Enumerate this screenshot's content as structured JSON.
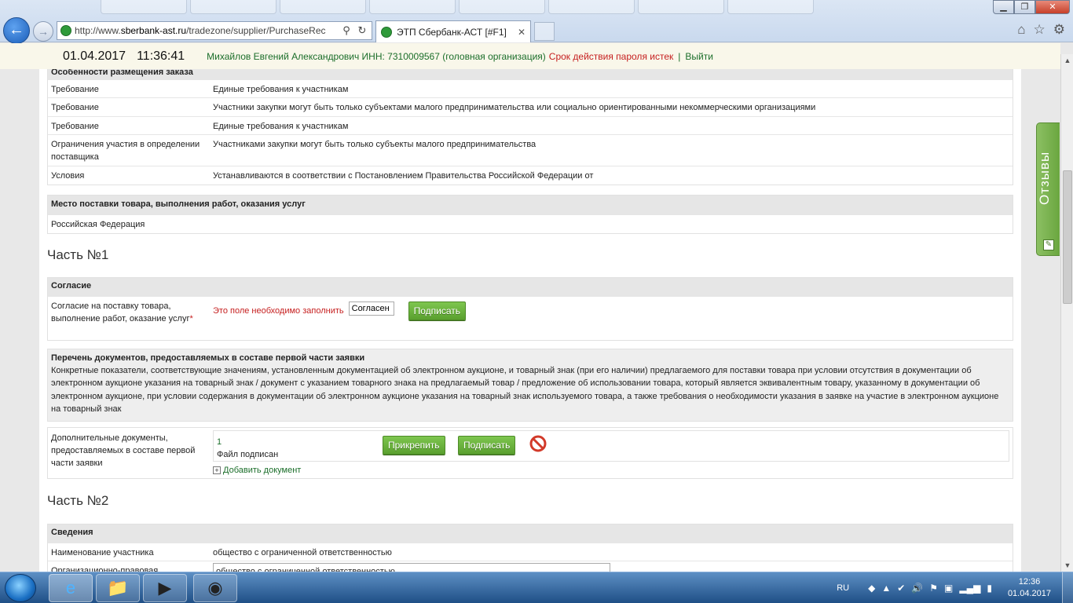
{
  "browser": {
    "url_prefix": "http://www.",
    "url_domain": "sberbank-ast.ru",
    "url_path": "/tradezone/supplier/PurchaseRec",
    "tab_title": "ЭТП Сбербанк-АСТ [#F1]",
    "close_symbol": "✕",
    "min_symbol": "▁",
    "max_symbol": "❐",
    "search_symbol": "⚲",
    "refresh_symbol": "↻",
    "tab_close_symbol": "✕"
  },
  "header": {
    "date": "01.04.2017",
    "time": "11:36:41",
    "user": "Михайлов Евгений Александрович ИНН: 7310009567 (головная организация)",
    "password_warning": "Срок действия пароля истек",
    "separator": "|",
    "logout": "Выйти"
  },
  "feedback": {
    "label": "Отзывы"
  },
  "placement": {
    "title": "Особенности размещения заказа",
    "rows": [
      {
        "label": "Требование",
        "value": "Единые требования к участникам"
      },
      {
        "label": "Требование",
        "value": "Участники закупки могут быть только субъектами малого предпринимательства или социально ориентированными некоммерческими организациями"
      },
      {
        "label": "Требование",
        "value": "Единые требования к участникам"
      },
      {
        "label": "Ограничения участия в определении поставщика",
        "value": "Участниками закупки могут быть только субъекты малого предпринимательства"
      },
      {
        "label": "Условия",
        "value": "Устанавливаются в соответствии с Постановлением Правительства Российской Федерации от"
      }
    ]
  },
  "delivery": {
    "title": "Место поставки товара, выполнения работ, оказания услуг",
    "value": "Российская Федерация"
  },
  "part1": {
    "title": "Часть №1",
    "consent": {
      "title": "Согласие",
      "label": "Согласие на поставку товара, выполнение работ, оказание услуг",
      "required_mark": "*",
      "error": "Это поле необходимо заполнить",
      "input_value": "Согласен",
      "sign_button": "Подписать"
    },
    "docs": {
      "title": "Перечень документов, предоставляемых в составе первой части заявки",
      "description": "Конкретные показатели, соответствующие значениям, установленным документацией об электронном аукционе, и товарный знак (при его наличии) предлагаемого для поставки товара при условии отсутствия в документации об электронном аукционе указания на товарный знак / документ с указанием товарного знака на предлагаемый товар / предложение об использовании товара, который является эквивалентным товару, указанному в документации об электронном аукционе, при условии содержания в документации об электронном аукционе указания на товарный знак используемого товара, а также требования о необходимости указания в заявке на участие в электронном аукционе на товарный знак"
    },
    "additional": {
      "label": "Дополнительные документы, предоставляемых в составе первой части заявки",
      "file_name": "1",
      "file_status": "Файл подписан",
      "attach_button": "Прикрепить",
      "sign_button": "Подписать",
      "add_link": "Добавить документ",
      "plus_symbol": "+"
    }
  },
  "part2": {
    "title": "Часть №2",
    "info": {
      "title": "Сведения",
      "participant_label": "Наименование участника",
      "participant_value": "общество с ограниченной ответственностью",
      "org_form_label": "Организационно-правовая",
      "org_form_value": "общество с ограниченной ответственностью"
    }
  },
  "taskbar": {
    "lang": "RU",
    "time": "12:36",
    "date": "01.04.2017"
  }
}
